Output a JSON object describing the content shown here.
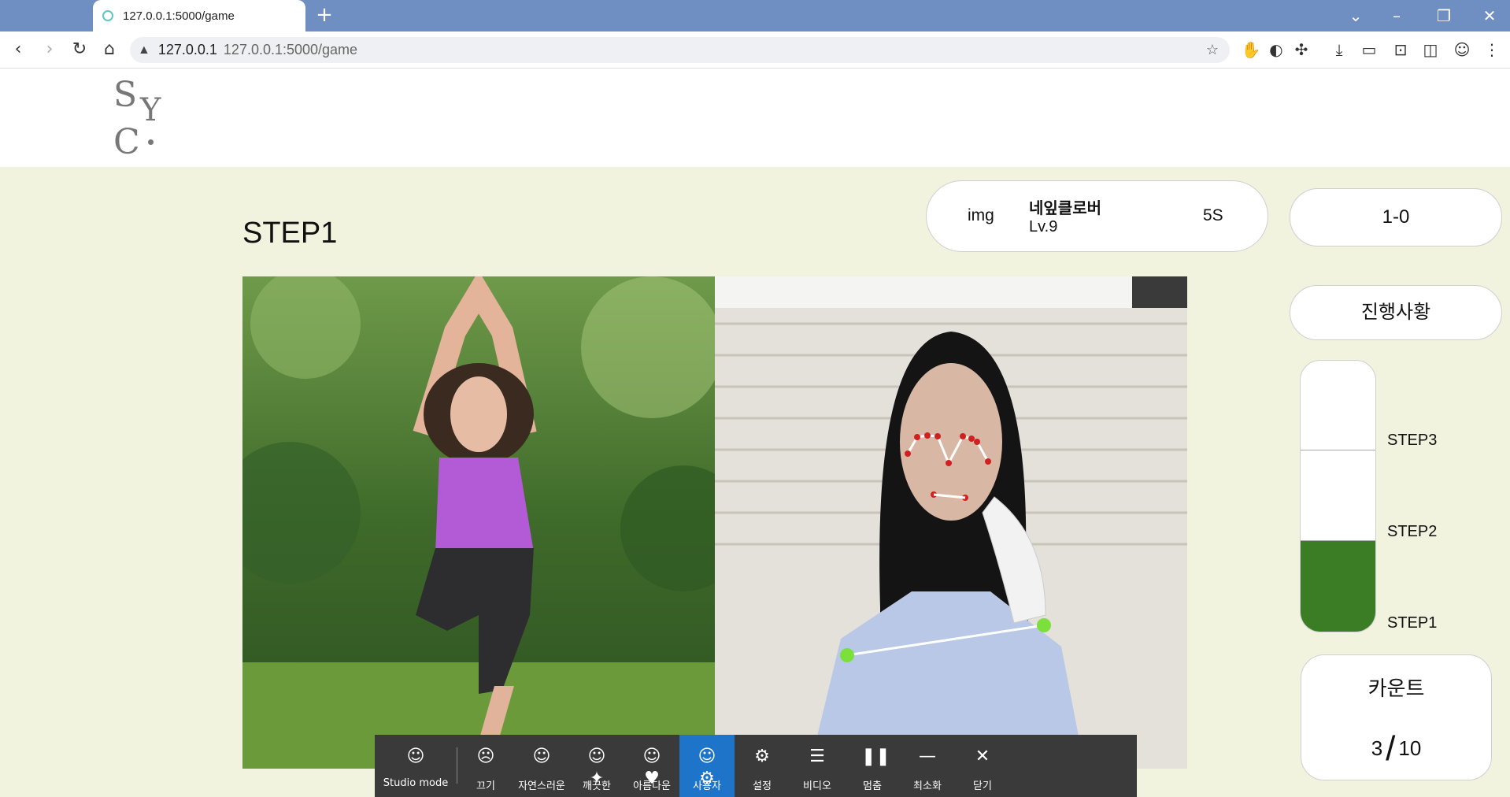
{
  "browser": {
    "tab_title": "127.0.0.1:5000/game",
    "url_host": "127.0.0.1",
    "url_full": "127.0.0.1:5000/game"
  },
  "logo": {
    "text": "SYC"
  },
  "step_title": "STEP1",
  "player": {
    "img_text": "img",
    "name": "네잎클로버",
    "level": "Lv.9",
    "time": "5S"
  },
  "score": "1-0",
  "progress": {
    "title": "진행사황",
    "steps": [
      "STEP3",
      "STEP2",
      "STEP1"
    ],
    "completed_fraction": 0.333,
    "fill_color": "#3b7d24"
  },
  "count": {
    "title": "카운트",
    "current": "3",
    "total": "10"
  },
  "toolbar": {
    "items": [
      {
        "label": "Studio mode",
        "icon": "face-icon"
      },
      {
        "label": "끄기",
        "icon": "face-off-icon"
      },
      {
        "label": "자연스러운",
        "icon": "face-natural-icon"
      },
      {
        "label": "깨끗한",
        "icon": "face-sparkle-icon"
      },
      {
        "label": "아름다운",
        "icon": "face-heart-icon"
      },
      {
        "label": "사용자",
        "icon": "face-gear-icon",
        "active": true
      },
      {
        "label": "설정",
        "icon": "gear-icon"
      },
      {
        "label": "비디오",
        "icon": "list-icon"
      },
      {
        "label": "멈춤",
        "icon": "pause-icon"
      },
      {
        "label": "최소화",
        "icon": "minimize-icon"
      },
      {
        "label": "닫기",
        "icon": "close-icon"
      }
    ],
    "active_color": "#1d74c9"
  }
}
